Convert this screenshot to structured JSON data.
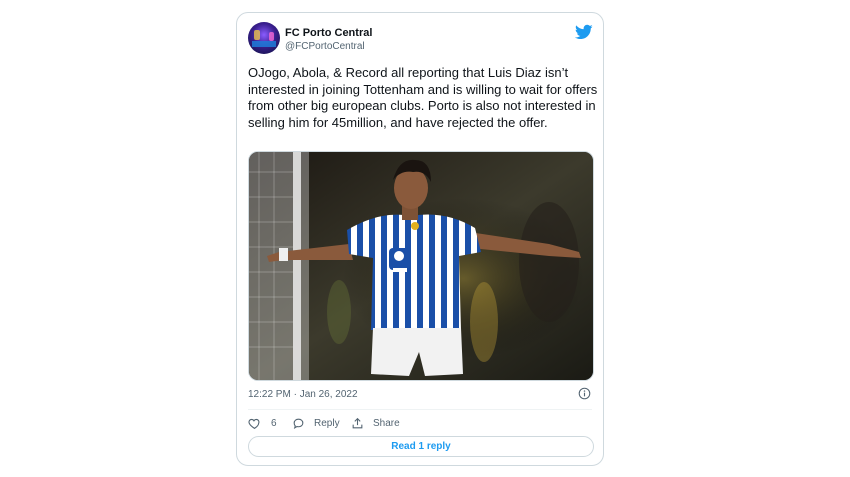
{
  "tweet": {
    "author_name": "FC Porto Central",
    "author_handle": "@FCPortoCentral",
    "text": "OJogo, Abola, & Record all reporting that Luis Diaz isn’t interested in joining Tottenham and is willing to wait for offers from other big european clubs. Porto is also not interested in selling him for 45million, and have rejected the offer.",
    "timestamp": "12:22 PM · Jan 26, 2022",
    "like_count": "6",
    "reply_label": "Reply",
    "share_label": "Share",
    "read_replies_label": "Read 1 reply"
  },
  "icons": {
    "brand": "twitter-bird-icon",
    "like": "heart-icon",
    "reply": "speech-bubble-icon",
    "share": "share-arrow-icon",
    "info": "info-icon"
  },
  "colors": {
    "accent": "#1d9bf0",
    "muted_text": "#536471",
    "border": "#cfd9de",
    "kit_blue": "#1a4fa8",
    "kit_white": "#ffffff"
  }
}
